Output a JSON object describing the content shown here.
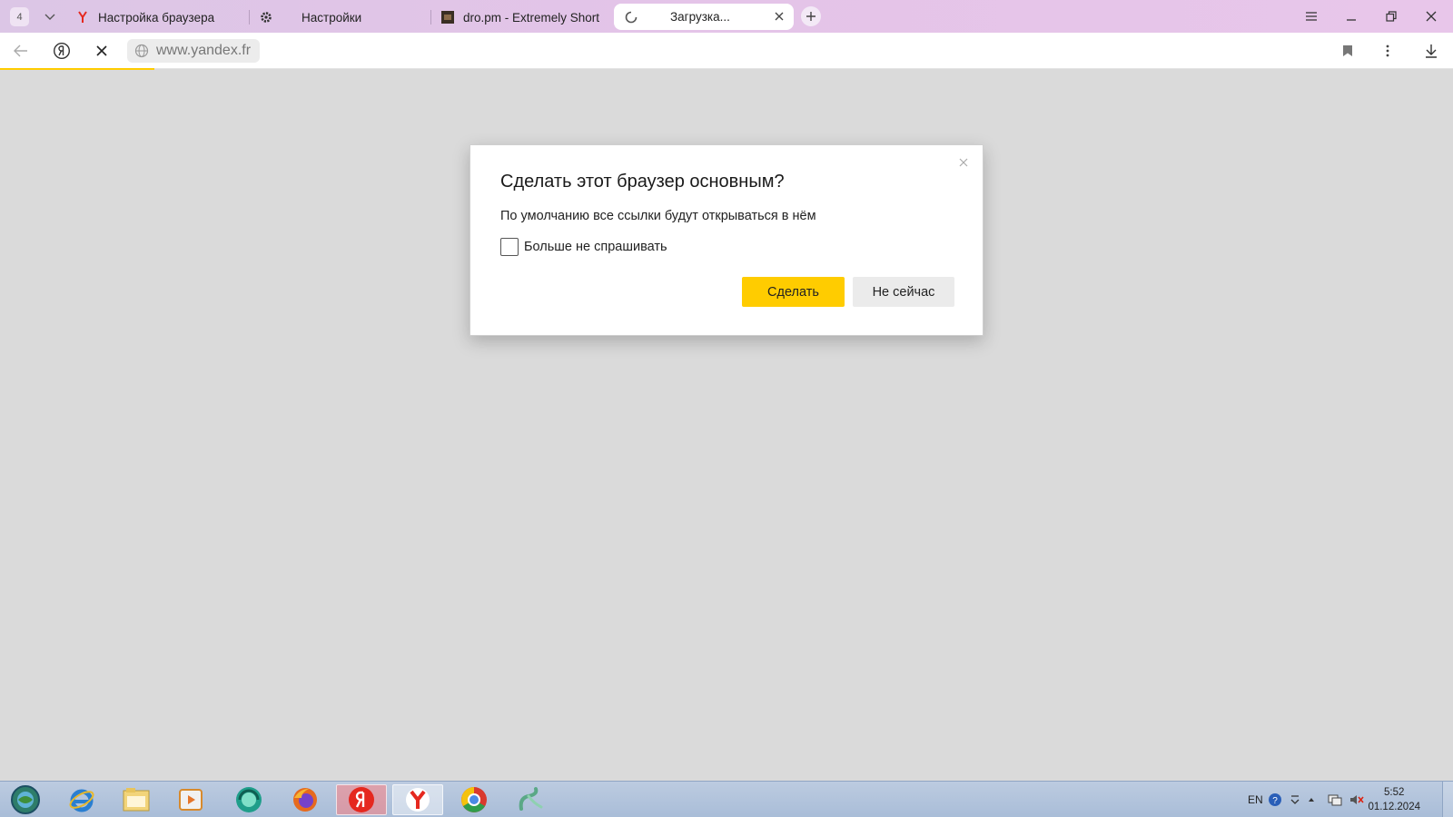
{
  "browser": {
    "tab_count": "4",
    "tabs": [
      {
        "label": "Настройка браузера",
        "icon": "yandex-y-icon"
      },
      {
        "label": "Настройки",
        "icon": "gear-icon"
      },
      {
        "label": "dro.pm - Extremely Short",
        "icon": "dro-pm-favicon"
      },
      {
        "label": "Загрузка...",
        "icon": "loading-spinner-icon"
      }
    ],
    "address": "www.yandex.fr",
    "accent": "#ffcc00"
  },
  "dialog": {
    "title": "Сделать этот браузер основным?",
    "text": "По умолчанию все ссылки будут открываться в нём",
    "checkbox_label": "Больше не спрашивать",
    "checkbox_checked": false,
    "primary_button": "Сделать",
    "secondary_button": "Не сейчас"
  },
  "taskbar": {
    "apps": [
      "start-orb",
      "internet-explorer",
      "file-explorer",
      "media-player",
      "green-app",
      "firefox",
      "yandex-browser-old",
      "yandex-browser",
      "chrome-like",
      "snake-app"
    ],
    "lang": "EN",
    "time": "5:52",
    "date": "01.12.2024"
  }
}
